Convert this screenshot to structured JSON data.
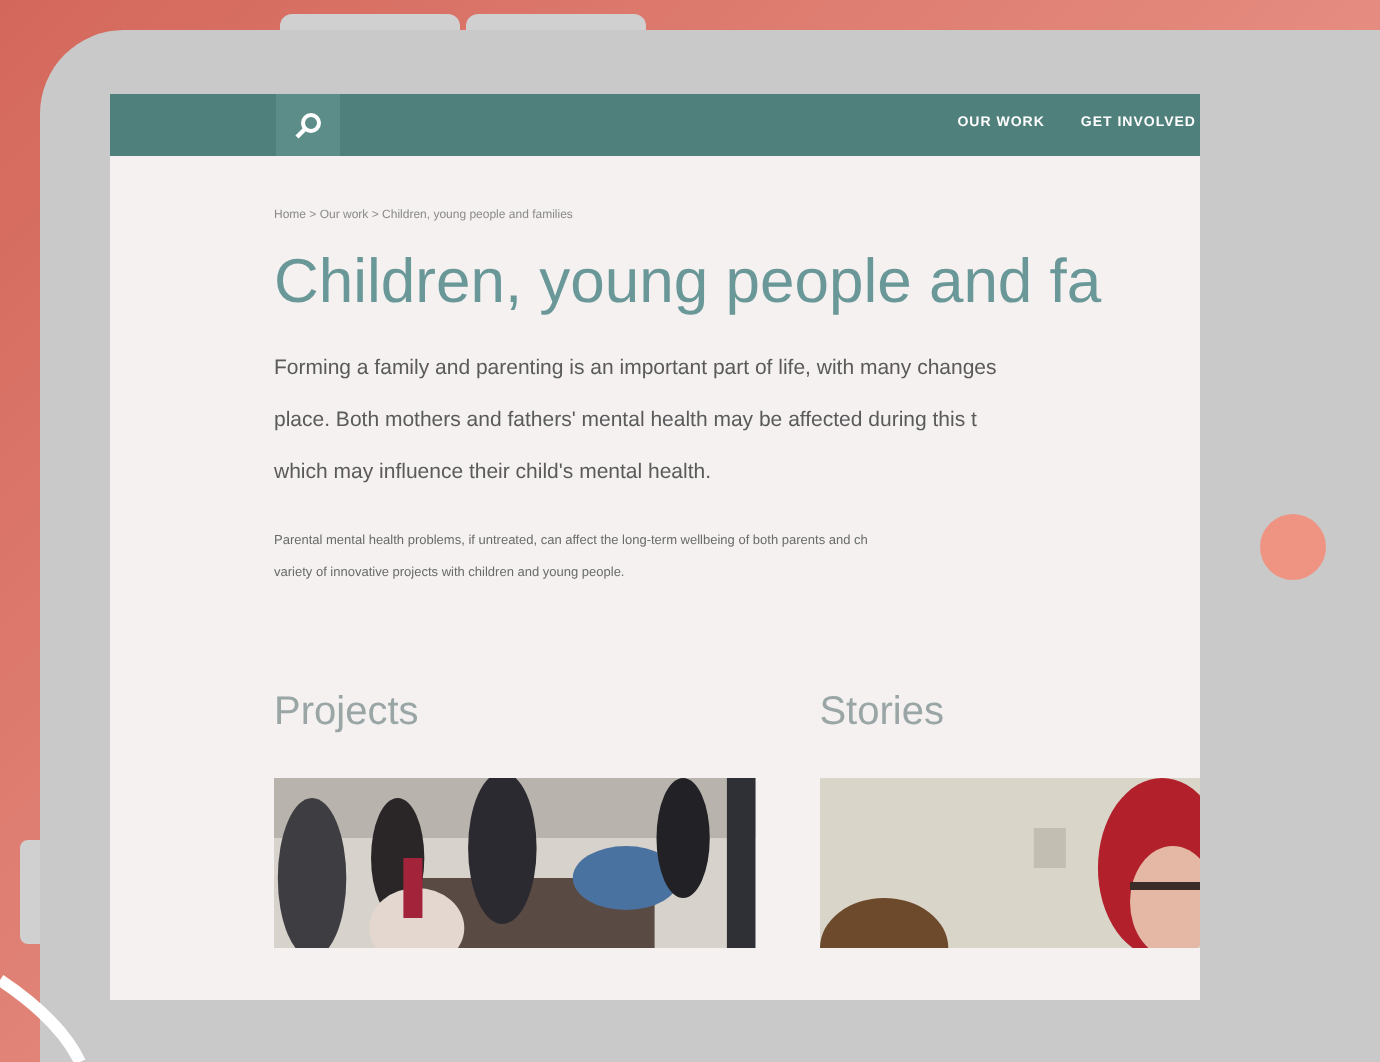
{
  "nav": {
    "items": [
      "OUR WORK",
      "GET INVOLVED"
    ]
  },
  "breadcrumb": "Home > Our work > Children, young people and families",
  "title": "Children, young people and fa",
  "intro_lines": [
    "Forming a family and parenting is an important part of life, with many changes",
    "place. Both mothers and fathers' mental health may be affected during this t",
    "which may influence their child's mental health."
  ],
  "note_lines": [
    "Parental mental health problems, if untreated, can affect the long-term wellbeing of both parents and ch",
    "variety of innovative projects with children and young people."
  ],
  "sections": [
    {
      "heading": "Projects",
      "kind": "group"
    },
    {
      "heading": "Stories",
      "kind": "portrait"
    }
  ]
}
